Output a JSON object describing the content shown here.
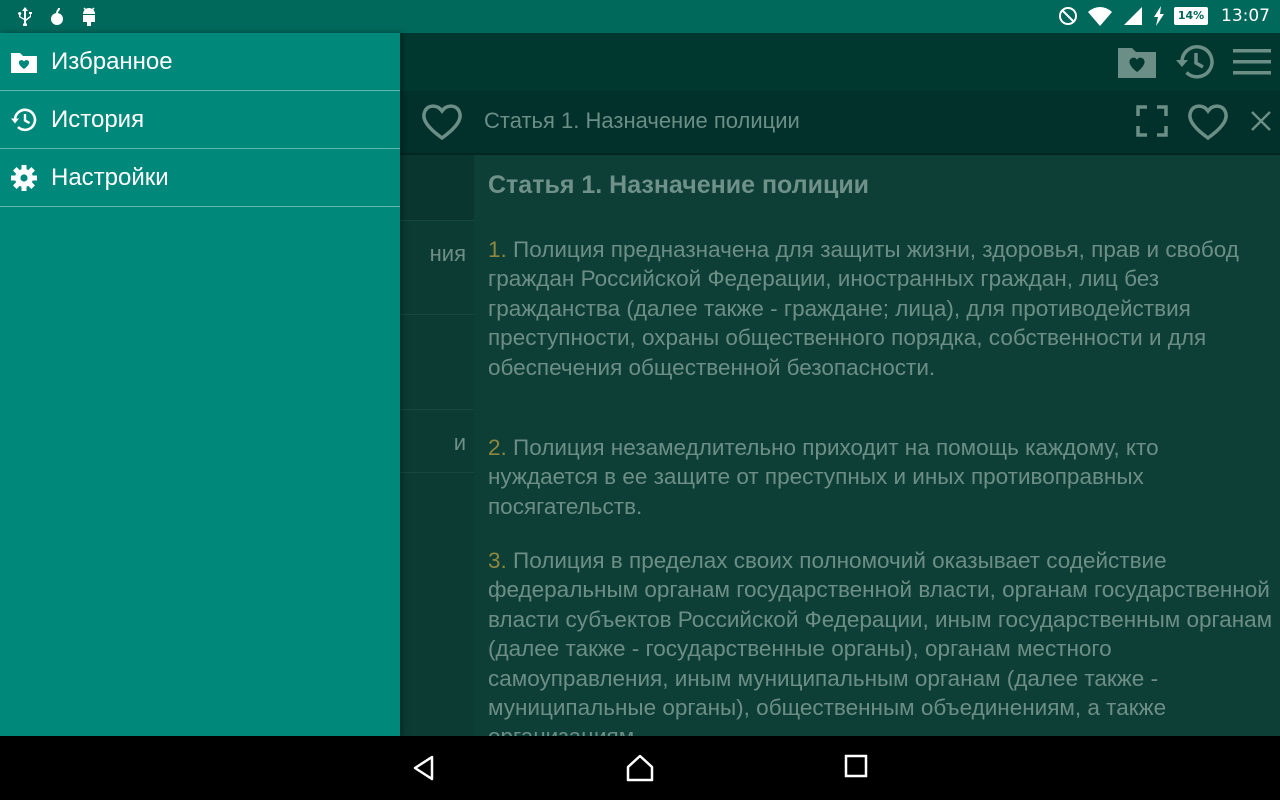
{
  "status_bar": {
    "time": "13:07",
    "battery_percent": "14%",
    "icons_left": [
      "usb-icon",
      "notification-drop-icon",
      "android-debug-icon"
    ],
    "icons_right": [
      "do-not-disturb-icon",
      "wifi-icon",
      "cell-signal-icon",
      "charging-bolt-icon",
      "battery-icon"
    ]
  },
  "drawer": {
    "items": [
      {
        "label": "Избранное",
        "icon": "favorites-folder-icon"
      },
      {
        "label": "История",
        "icon": "history-icon"
      },
      {
        "label": "Настройки",
        "icon": "gear-icon"
      }
    ]
  },
  "toolbar": {
    "icons": [
      "favorites-folder-icon",
      "history-icon",
      "menu-icon"
    ]
  },
  "tab": {
    "title": "Статья 1. Назначение полиции",
    "icons": [
      "heart-outline-icon",
      "fullscreen-icon",
      "heart-outline-icon",
      "close-icon"
    ]
  },
  "article_list": {
    "rows": [
      {
        "text": ""
      },
      {
        "text": "ния"
      },
      {
        "text": ""
      },
      {
        "text": "и"
      }
    ]
  },
  "content": {
    "title": "Статья 1. Назначение полиции",
    "paragraphs": [
      {
        "num": "1.",
        "text": "Полиция предназначена для защиты жизни, здоровья, прав и свобод граждан Российской Федерации, иностранных граждан, лиц без гражданства (далее также - граждане; лица), для противодействия преступности, охраны общественного порядка, собственности и для обеспечения общественной безопасности."
      },
      {
        "num": "2.",
        "text": "Полиция незамедлительно приходит на помощь каждому, кто нуждается в ее защите от преступных и иных противоправных посягательств."
      },
      {
        "num": "3.",
        "text": "Полиция в пределах своих полномочий оказывает содействие федеральным органам государственной власти, органам государственной власти субъектов Российской Федерации, иным государственным органам (далее также - государственные органы), органам местного самоуправления, иным муниципальным органам (далее также - муниципальные органы), общественным объединениям, а также организациям"
      }
    ]
  },
  "colors": {
    "status_bar": "#00695c",
    "drawer": "#00897b",
    "content_bg": "#0d3f36",
    "number_accent": "#8d8740"
  }
}
